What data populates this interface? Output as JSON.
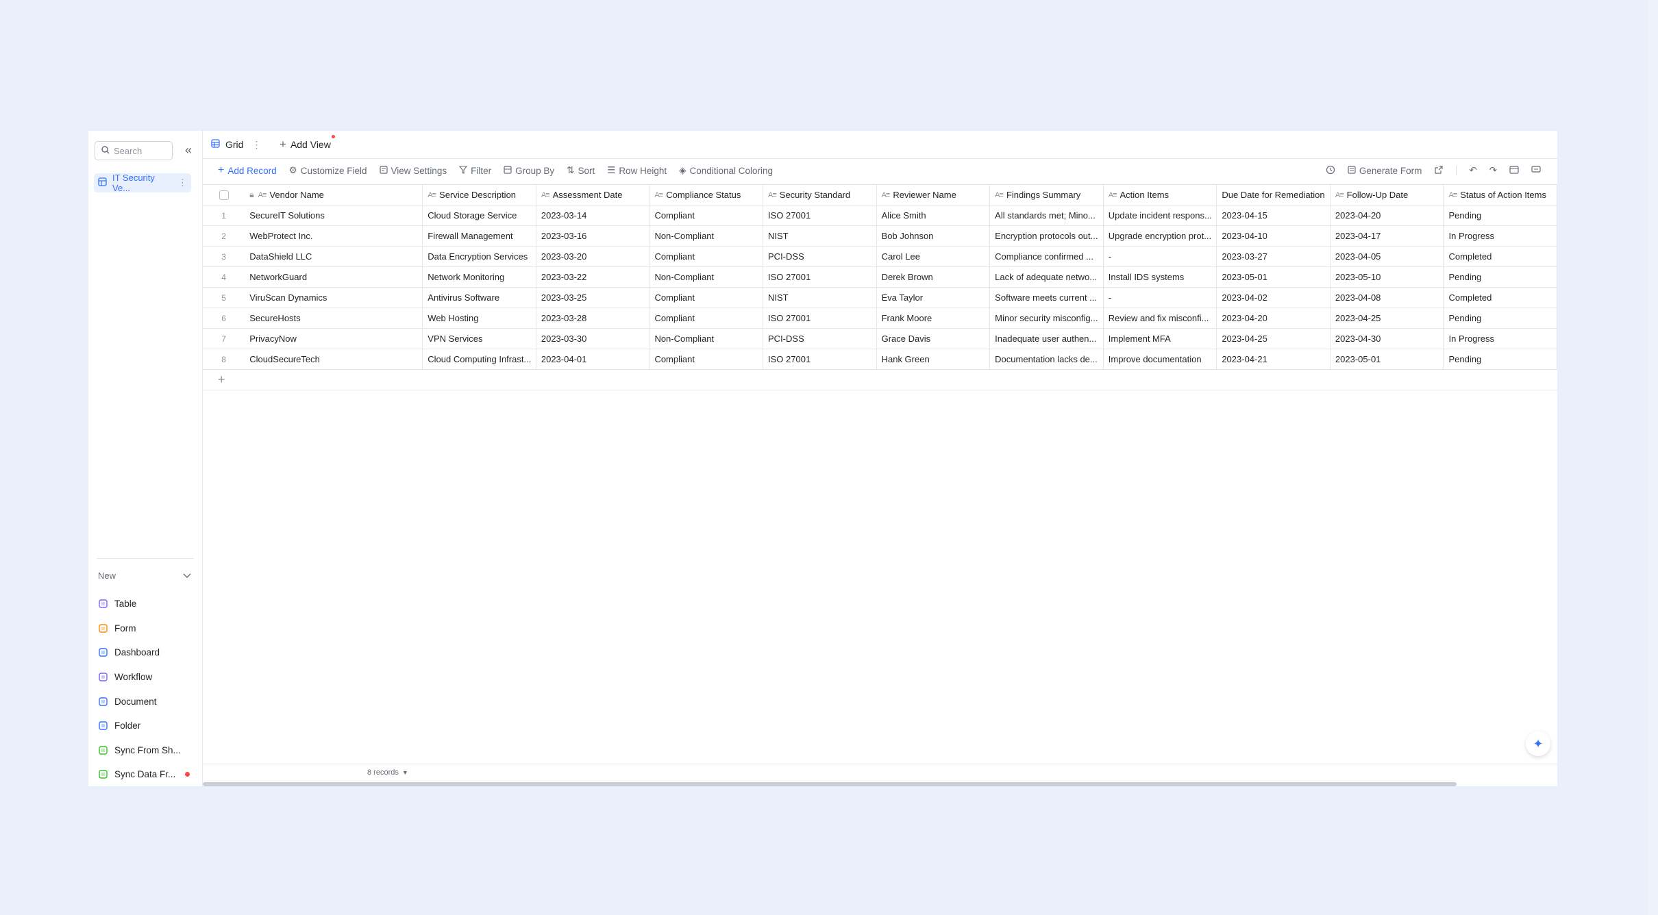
{
  "sidebar": {
    "search_placeholder": "Search",
    "table_name": "IT Security Ve...",
    "new_label": "New",
    "new_items": [
      {
        "label": "Table",
        "icon": "table-icon",
        "color": "#7b61ff"
      },
      {
        "label": "Form",
        "icon": "form-icon",
        "color": "#ff8800"
      },
      {
        "label": "Dashboard",
        "icon": "dashboard-icon",
        "color": "#3370ff"
      },
      {
        "label": "Workflow",
        "icon": "workflow-icon",
        "color": "#7b61ff"
      },
      {
        "label": "Document",
        "icon": "document-icon",
        "color": "#3370ff"
      },
      {
        "label": "Folder",
        "icon": "folder-icon",
        "color": "#3370ff"
      },
      {
        "label": "Sync From Sh...",
        "icon": "sync-sheet-icon",
        "color": "#34c724"
      },
      {
        "label": "Sync Data Fr...",
        "icon": "sync-data-icon",
        "color": "#34c724"
      }
    ]
  },
  "tabs": {
    "grid_label": "Grid",
    "add_view_label": "Add View"
  },
  "toolbar": {
    "add_record": "Add Record",
    "customize_field": "Customize Field",
    "view_settings": "View Settings",
    "filter": "Filter",
    "group_by": "Group By",
    "sort": "Sort",
    "row_height": "Row Height",
    "conditional_coloring": "Conditional Coloring",
    "generate_form": "Generate Form"
  },
  "table": {
    "columns": [
      "Vendor Name",
      "Service Description",
      "Assessment Date",
      "Compliance Status",
      "Security Standard",
      "Reviewer Name",
      "Findings Summary",
      "Action Items",
      "Due Date for Remediation",
      "Follow-Up Date",
      "Status of Action Items"
    ],
    "rows": [
      [
        "1",
        "SecureIT Solutions",
        "Cloud Storage Service",
        "2023-03-14",
        "Compliant",
        "ISO 27001",
        "Alice Smith",
        "All standards met; Mino...",
        "Update incident respons...",
        "2023-04-15",
        "2023-04-20",
        "Pending"
      ],
      [
        "2",
        "WebProtect Inc.",
        "Firewall Management",
        "2023-03-16",
        "Non-Compliant",
        "NIST",
        "Bob Johnson",
        "Encryption protocols out...",
        "Upgrade encryption prot...",
        "2023-04-10",
        "2023-04-17",
        "In Progress"
      ],
      [
        "3",
        "DataShield LLC",
        "Data Encryption Services",
        "2023-03-20",
        "Compliant",
        "PCI-DSS",
        "Carol Lee",
        "Compliance confirmed ...",
        "-",
        "2023-03-27",
        "2023-04-05",
        "Completed"
      ],
      [
        "4",
        "NetworkGuard",
        "Network Monitoring",
        "2023-03-22",
        "Non-Compliant",
        "ISO 27001",
        "Derek Brown",
        "Lack of adequate netwo...",
        "Install IDS systems",
        "2023-05-01",
        "2023-05-10",
        "Pending"
      ],
      [
        "5",
        "ViruScan Dynamics",
        "Antivirus Software",
        "2023-03-25",
        "Compliant",
        "NIST",
        "Eva Taylor",
        "Software meets current ...",
        "-",
        "2023-04-02",
        "2023-04-08",
        "Completed"
      ],
      [
        "6",
        "SecureHosts",
        "Web Hosting",
        "2023-03-28",
        "Compliant",
        "ISO 27001",
        "Frank Moore",
        "Minor security misconfig...",
        "Review and fix misconfi...",
        "2023-04-20",
        "2023-04-25",
        "Pending"
      ],
      [
        "7",
        "PrivacyNow",
        "VPN Services",
        "2023-03-30",
        "Non-Compliant",
        "PCI-DSS",
        "Grace Davis",
        "Inadequate user authen...",
        "Implement MFA",
        "2023-04-25",
        "2023-04-30",
        "In Progress"
      ],
      [
        "8",
        "CloudSecureTech",
        "Cloud Computing Infrast...",
        "2023-04-01",
        "Compliant",
        "ISO 27001",
        "Hank Green",
        "Documentation lacks de...",
        "Improve documentation",
        "2023-04-21",
        "2023-05-01",
        "Pending"
      ]
    ]
  },
  "footer": {
    "records": "8 records"
  },
  "colors": {
    "accent": "#3370ff",
    "background": "#eaf0fb"
  }
}
